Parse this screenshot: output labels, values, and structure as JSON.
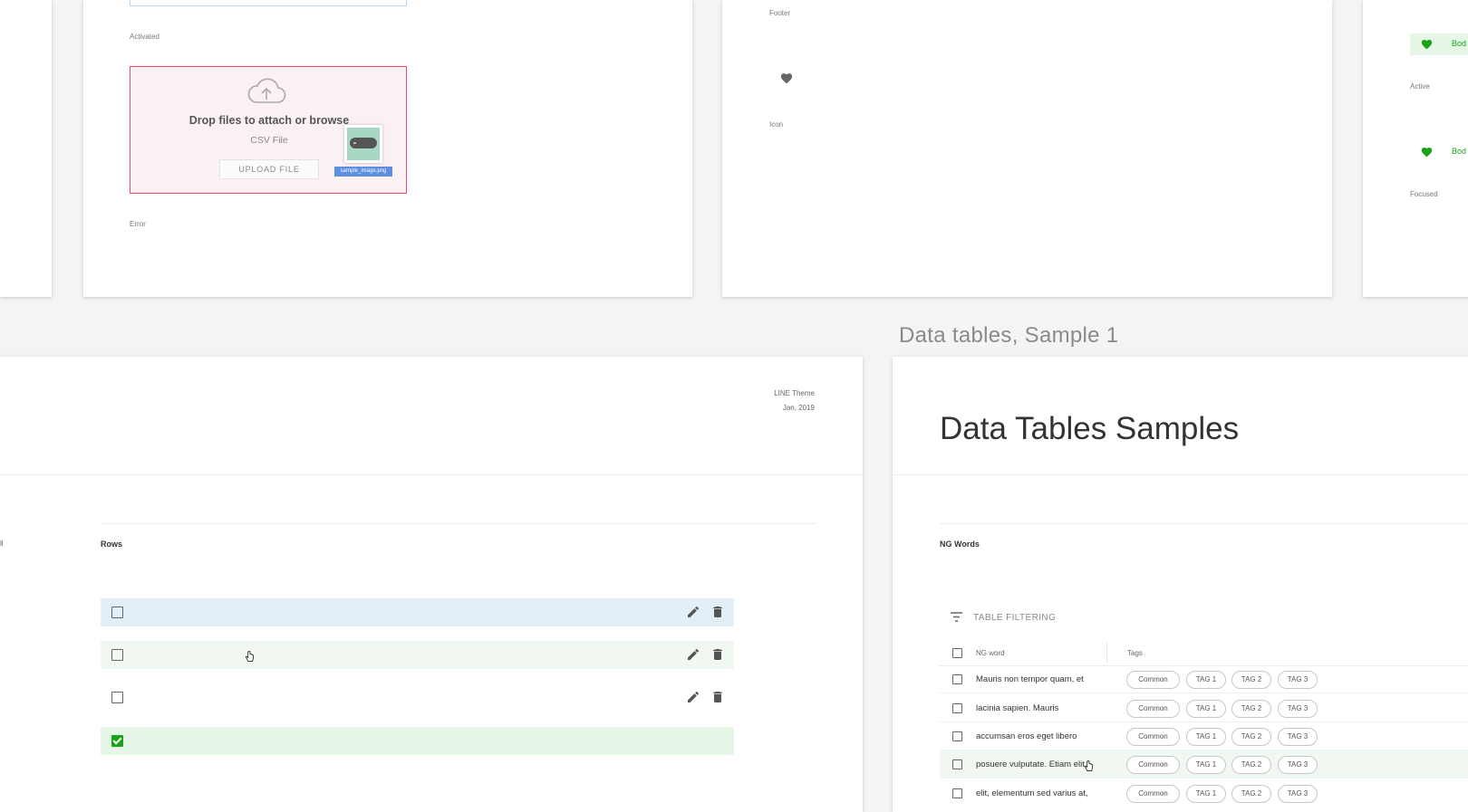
{
  "upload_board": {
    "activated_label": "Activated",
    "dropzone_title": "Drop files to attach or browse",
    "dropzone_subtitle": "CSV File",
    "upload_button": "UPLOAD FILE",
    "filename": "sample_image.png",
    "error_label": "Error"
  },
  "heart_board": {
    "footer_label": "Footer",
    "icon_label": "Icon"
  },
  "right_partial": {
    "active_label": "Active",
    "focused_label": "Focused",
    "item_text": "Bod"
  },
  "section_title": "Data tables, Sample 1",
  "rows_board": {
    "theme": "LINE Theme",
    "date": "Jan, 2019",
    "rows_label": "Rows",
    "left_edge_label": "ll",
    "rows": [
      {
        "state": "selected",
        "color": "#e3eff7",
        "checked": false
      },
      {
        "state": "hover",
        "color": "#f1f8f1",
        "checked": false
      },
      {
        "state": "default",
        "color": "#ffffff",
        "checked": false
      },
      {
        "state": "checked",
        "color": "#e6f6e6",
        "checked": true
      }
    ]
  },
  "table_board": {
    "title": "Data Tables Samples",
    "section_label": "NG Words",
    "filter_label": "TABLE FILTERING",
    "col_word": "NG word",
    "col_tags": "Tags",
    "rows": [
      {
        "word": "Mauris non tempor quam, et",
        "tags": [
          "Common",
          "TAG 1",
          "TAG 2",
          "TAG 3"
        ]
      },
      {
        "word": "lacinia sapien. Mauris",
        "tags": [
          "Common",
          "TAG 1",
          "TAG 2",
          "TAG 3"
        ]
      },
      {
        "word": "accumsan eros eget libero",
        "tags": [
          "Common",
          "TAG 1",
          "TAG 2",
          "TAG 3"
        ]
      },
      {
        "word": "posuere vulputate. Etiam elit,",
        "tags": [
          "Common",
          "TAG 1",
          "TAG 2",
          "TAG 3"
        ]
      },
      {
        "word": "elit, elementum sed varius at,",
        "tags": [
          "Common",
          "TAG 1",
          "TAG 2",
          "TAG 3"
        ]
      }
    ]
  },
  "colors": {
    "accent_green": "#1aa31a",
    "error_red": "#e94a6a",
    "selected_blue": "#e3eff7"
  }
}
